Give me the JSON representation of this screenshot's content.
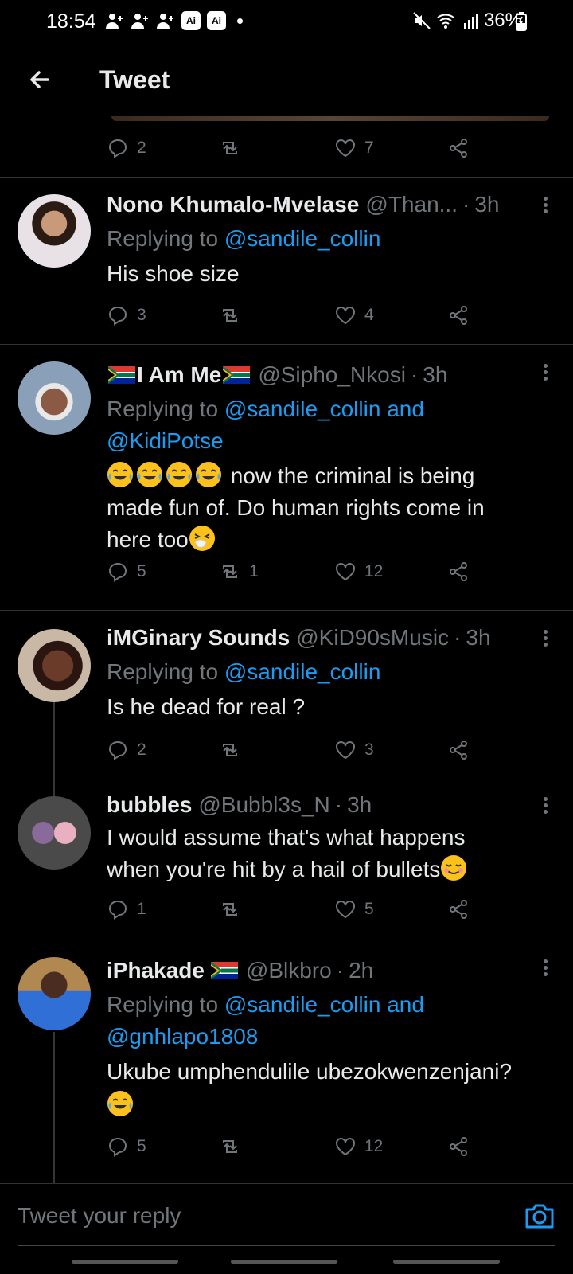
{
  "status_bar": {
    "time": "18:54",
    "ai_label_1": "Ai",
    "ai_label_2": "Ai",
    "battery": "36%"
  },
  "header": {
    "title": "Tweet",
    "back_icon": "arrow-left-icon"
  },
  "previous_tweet_actions": {
    "replies": "2",
    "retweets": "",
    "likes": "7"
  },
  "tweets": [
    {
      "name": "Nono Khumalo-Mvelase",
      "handle": "@Than...",
      "time": "3h",
      "replying_prefix": "Replying to",
      "replying_to": "@sandile_collin",
      "lines": [
        "His shoe size"
      ],
      "replies": "3",
      "retweets": "",
      "likes": "4"
    },
    {
      "name": "I Am Me",
      "handle": "@Sipho_Nkosi",
      "time": "3h",
      "replying_prefix": "Replying to",
      "replying_to": "@sandile_collin and",
      "replying_to_2": "@KidiPotse",
      "lines": [
        "now the criminal is being",
        "made fun of. Do human rights come in",
        "here too"
      ],
      "replies": "5",
      "retweets": "1",
      "likes": "12"
    },
    {
      "name": "iMGinary Sounds",
      "handle": "@KiD90sMusic",
      "time": "3h",
      "replying_prefix": "Replying to",
      "replying_to": "@sandile_collin",
      "lines": [
        "Is he dead for real ?"
      ],
      "replies": "2",
      "retweets": "",
      "likes": "3"
    },
    {
      "name": "bubbles",
      "handle": "@Bubbl3s_N",
      "time": "3h",
      "lines": [
        "I would assume that's what happens",
        "when you're hit by a hail of bullets"
      ],
      "replies": "1",
      "retweets": "",
      "likes": "5"
    },
    {
      "name": "iPhakade",
      "handle": "@Blkbro",
      "time": "2h",
      "replying_prefix": "Replying to",
      "replying_to": "@sandile_collin and",
      "replying_to_2": "@gnhlapo1808",
      "lines": [
        "Ukube umphendulile ubezokwenzenjani?"
      ],
      "replies": "5",
      "retweets": "",
      "likes": "12"
    }
  ],
  "composer": {
    "placeholder": "Tweet your reply",
    "camera_icon": "camera-icon"
  },
  "colors": {
    "background": "#000000",
    "text": "#e7e9ea",
    "muted": "#71767b",
    "link": "#1d9bf0",
    "divider": "#2f3336"
  }
}
